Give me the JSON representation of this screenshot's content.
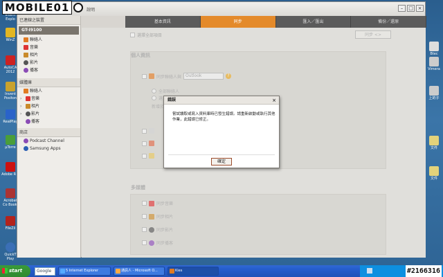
{
  "watermark": {
    "text": "MOBILE01"
  },
  "app": {
    "title": "說明",
    "tabs": [
      "基本資訊",
      "同步",
      "匯入／匯出",
      "備份／還原"
    ],
    "active_tab": 1
  },
  "sidebar": {
    "connected_header": "已連線之裝置",
    "device": "GT-I9100",
    "device_items": [
      "聯絡人",
      "音樂",
      "相片",
      "影片",
      "播客"
    ],
    "library_header": "媒體庫",
    "library_items": [
      "聯絡人",
      "音樂",
      "相片",
      "影片",
      "播客"
    ],
    "store_header": "商店",
    "store_items": [
      "Podcast Channel",
      "Samsung Apps"
    ]
  },
  "main": {
    "select_all_label": "選擇全部項目",
    "sync_button": "同步  <>",
    "personal_header": "個人資訊",
    "contacts_sync_label": "同步聯絡人與",
    "contacts_sync_target": "Outlook",
    "radio_all": "全部聯絡人",
    "radio_selected": "選",
    "new_label": "新增於",
    "multimedia_header": "多媒體",
    "media_rows": [
      "同步音樂",
      "同步相片",
      "同步影片",
      "同步播客"
    ]
  },
  "dialog": {
    "title": "錯誤",
    "message": "嘗試讀取或寫入資料庫時已發生錯誤。請重新啟動或執行其他作業，此錯誤已修正。",
    "ok_label": "確定",
    "close_glyph": "×"
  },
  "desktop_icons": [
    {
      "label": "Intern Explo"
    },
    {
      "label": "WinZ"
    },
    {
      "label": "AutoCA 2012"
    },
    {
      "label": "Invent Positon"
    },
    {
      "label": "RealPlay"
    },
    {
      "label": "µTorre"
    },
    {
      "label": "Adobe R 9"
    },
    {
      "label": "Acrobat Co Booki"
    },
    {
      "label": "FileZil"
    },
    {
      "label": "QuickT Play"
    }
  ],
  "right_icons": [
    {
      "label": "Btec"
    },
    {
      "label": "Vimera"
    },
    {
      "label": "上的子"
    },
    {
      "label": "文件"
    },
    {
      "label": "文件"
    }
  ],
  "taskbar": {
    "start": "start",
    "search": "Google",
    "buttons": [
      "5 Internet Explorer",
      "通訊人 - Microsoft O...",
      "Kies"
    ]
  },
  "counter": "#2166316",
  "colors": {
    "accent_tab": "#e48a2a",
    "device_bar": "#7a756d",
    "help": "#e8a51b"
  }
}
